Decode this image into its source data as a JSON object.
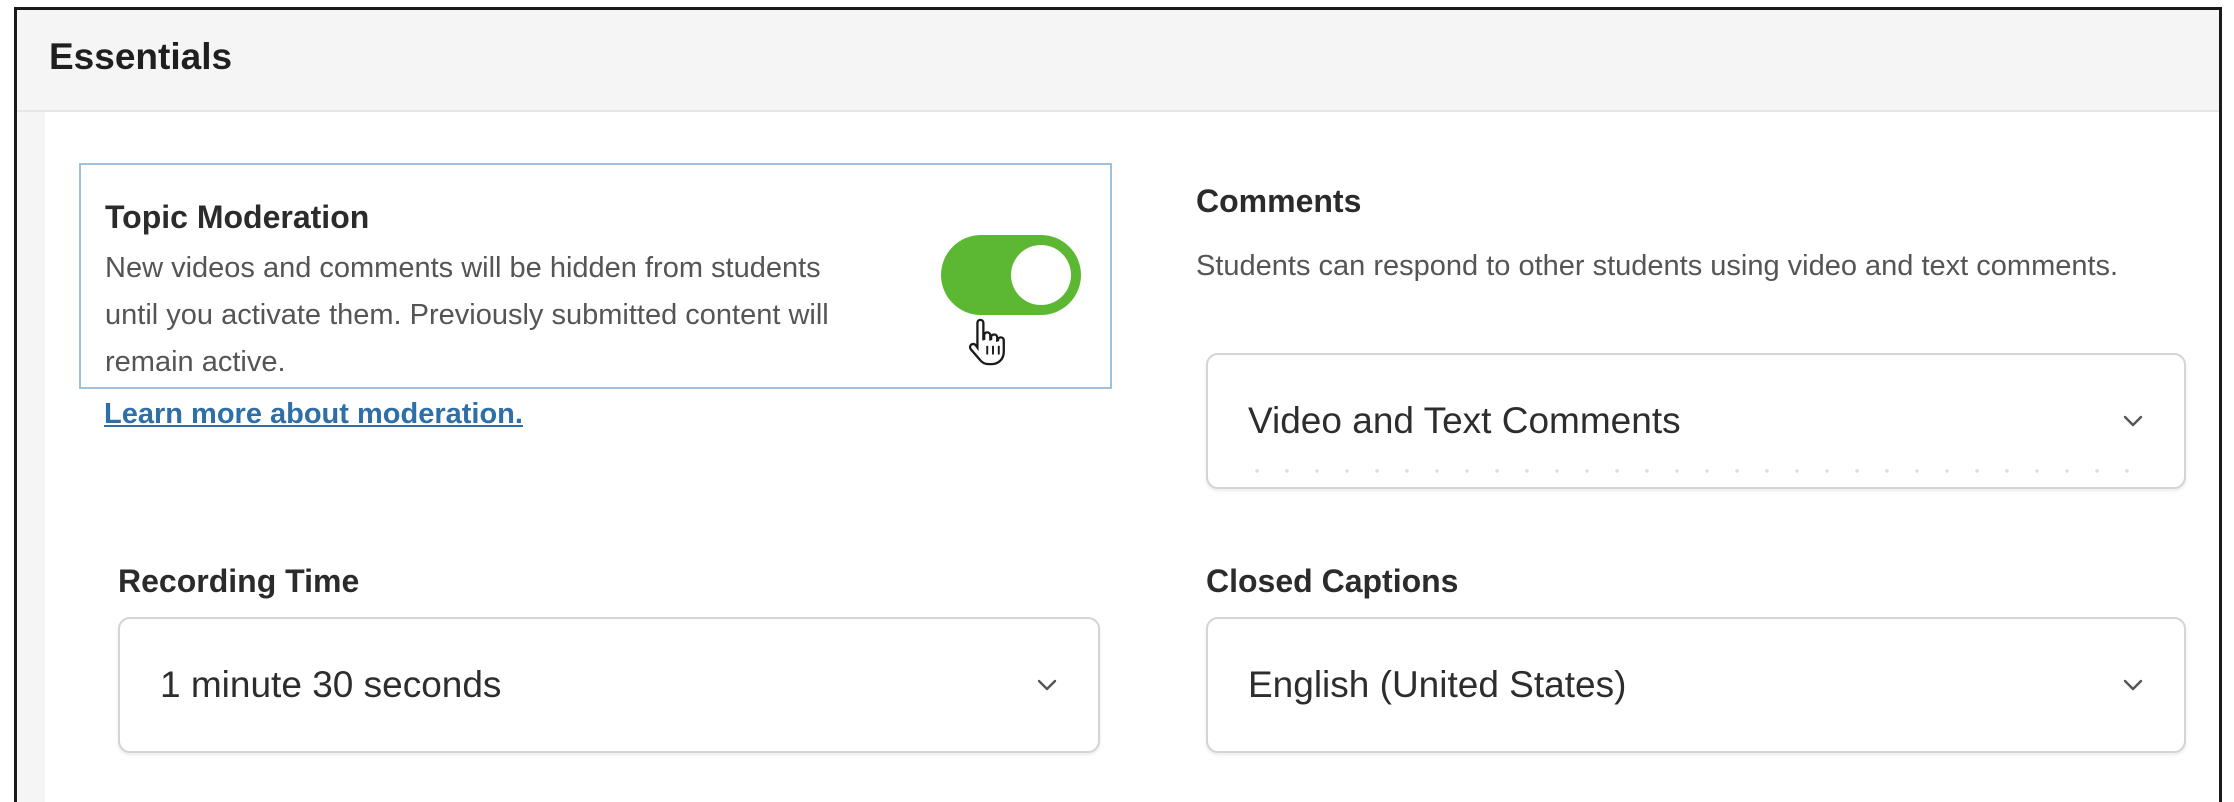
{
  "section": {
    "title": "Essentials"
  },
  "moderation": {
    "title": "Topic Moderation",
    "description": "New videos and comments will be hidden from students until you activate them. Previously submitted content will remain active.",
    "enabled": true,
    "learn_more_link": "Learn more about moderation."
  },
  "comments": {
    "label": "Comments",
    "description": "Students can respond to other students using video and text comments.",
    "selected": "Video and Text Comments"
  },
  "recording_time": {
    "label": "Recording Time",
    "selected": "1 minute 30 seconds"
  },
  "closed_captions": {
    "label": "Closed Captions",
    "selected": "English (United States)"
  },
  "colors": {
    "toggle_on": "#5cb832",
    "link": "#2e6fa7",
    "card_border": "#9dc1de"
  },
  "icons": {
    "chevron": "chevron-down-icon",
    "cursor": "hand-pointer-icon"
  }
}
